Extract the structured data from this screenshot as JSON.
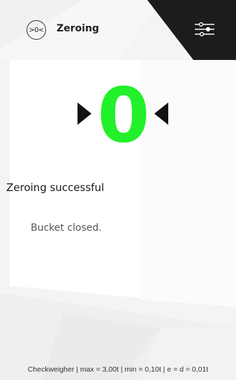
{
  "header": {
    "zero_icon_text": ">0<",
    "title": "Zeroing",
    "settings_icon": "settings-sliders-icon"
  },
  "display": {
    "value": "0",
    "left_indicator_icon": "triangle-right-icon",
    "right_indicator_icon": "triangle-left-icon",
    "value_color": "#22f02a"
  },
  "status": {
    "title": "Zeroing successful",
    "message": "Bucket closed."
  },
  "footer": {
    "text": "Checkweigher | max = 3,00t | min = 0,10t | e = d = 0,01t"
  },
  "colors": {
    "accent": "#22f02a",
    "header_panel": "#1c1c1c"
  }
}
